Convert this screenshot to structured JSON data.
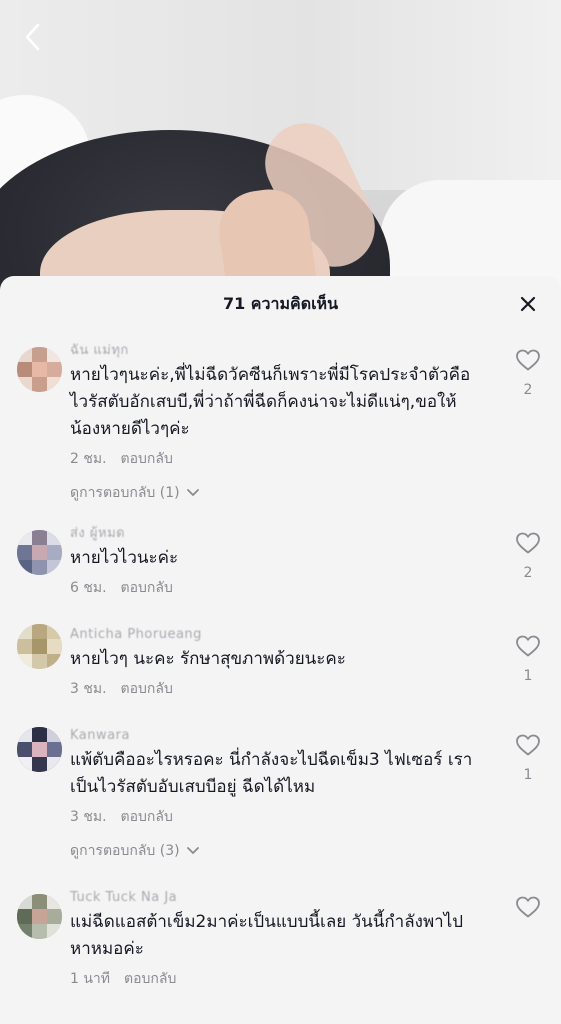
{
  "header": {
    "comment_count_title": "71 ความคิดเห็น"
  },
  "comments": [
    {
      "username": "ฉัน แม่ทุก",
      "text": "หายไวๆนะค่ะ,พี่ไม่ฉีดวัคซีนก็เพราะพี่มีโรคประจำตัวคือไวรัสตับอักเสบบี,พี่ว่าถ้าพี่ฉีดก็คงน่าจะไม่ดีแน่ๆ,ขอให้น้องหายดีไวๆค่ะ",
      "time": "2 ชม.",
      "reply_label": "ตอบกลับ",
      "view_replies": "ดูการตอบกลับ (1)",
      "likes": "2"
    },
    {
      "username": "ส่ง ผู้หมด",
      "text": "หายไวไวนะค่ะ",
      "time": "6 ชม.",
      "reply_label": "ตอบกลับ",
      "likes": "2"
    },
    {
      "username": "Anticha Phorueang",
      "text": "หายไวๆ นะคะ รักษาสุขภาพด้วยนะคะ",
      "time": "3 ชม.",
      "reply_label": "ตอบกลับ",
      "likes": "1"
    },
    {
      "username": "Kanwara",
      "text": "แพ้ตับคืออะไรหรอคะ นี่กำลังจะไปฉีดเข็ม3 ไฟเซอร์ เราเป็นไวรัสตับอับเสบบีอยู่ ฉีดได้ไหม",
      "time": "3 ชม.",
      "reply_label": "ตอบกลับ",
      "view_replies": "ดูการตอบกลับ (3)",
      "likes": "1"
    },
    {
      "username": "Tuck Tuck Na Ja",
      "text": "แม่ฉีดแอสต้าเข็ม2มาค่ะเป็นแบบนี้เลย วันนี้กำลังพาไปหาหมอค่ะ",
      "time": "1 นาที",
      "reply_label": "ตอบกลับ",
      "likes": ""
    }
  ],
  "icons": {
    "back": "chevron-left-icon",
    "close": "close-icon",
    "like": "heart-outline-icon",
    "expand": "chevron-down-icon"
  },
  "colors": {
    "sheet_bg": "#f4f4f4",
    "text_primary": "#161823",
    "text_secondary": "#8a8b91"
  }
}
